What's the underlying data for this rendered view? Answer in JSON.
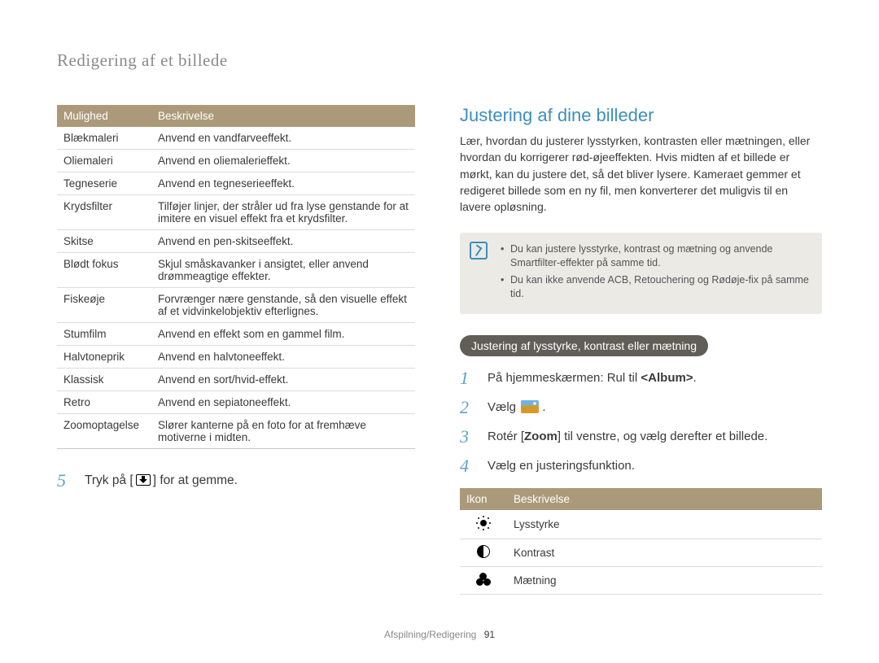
{
  "page_subtitle": "Redigering af et billede",
  "left_table": {
    "headers": [
      "Mulighed",
      "Beskrivelse"
    ],
    "rows": [
      {
        "opt": "Blækmaleri",
        "desc": "Anvend en vandfarveeffekt."
      },
      {
        "opt": "Oliemaleri",
        "desc": "Anvend en oliemalerieffekt."
      },
      {
        "opt": "Tegneserie",
        "desc": "Anvend en tegneserieeffekt."
      },
      {
        "opt": "Krydsfilter",
        "desc": "Tilføjer linjer, der stråler ud fra lyse genstande for at imitere en visuel effekt fra et krydsfilter."
      },
      {
        "opt": "Skitse",
        "desc": "Anvend en pen-skitseeffekt."
      },
      {
        "opt": "Blødt fokus",
        "desc": "Skjul småskavanker i ansigtet, eller anvend drømmeagtige effekter."
      },
      {
        "opt": "Fiskeøje",
        "desc": "Forvrænger nære genstande, så den visuelle effekt af et vidvinkelobjektiv efterlignes."
      },
      {
        "opt": "Stumfilm",
        "desc": "Anvend en effekt som en gammel film."
      },
      {
        "opt": "Halvtoneprik",
        "desc": "Anvend en halvtoneeffekt."
      },
      {
        "opt": "Klassisk",
        "desc": "Anvend en sort/hvid-effekt."
      },
      {
        "opt": "Retro",
        "desc": "Anvend en sepiatoneeffekt."
      },
      {
        "opt": "Zoomoptagelse",
        "desc": "Slører kanterne på en foto for at fremhæve motiverne i midten."
      }
    ]
  },
  "left_step": {
    "num": "5",
    "before": "Tryk på [",
    "after": "] for at gemme."
  },
  "right": {
    "title": "Justering af dine billeder",
    "body": "Lær, hvordan du justerer lysstyrken, kontrasten eller mætningen, eller hvordan du korrigerer rød-øjeeffekten. Hvis midten af et billede er mørkt, kan du justere det, så det bliver lysere. Kameraet gemmer et redigeret billede som en ny fil, men konverterer det muligvis til en lavere opløsning.",
    "notes": [
      "Du kan justere lysstyrke, kontrast og mætning og anvende Smartfilter-effekter på samme tid.",
      "Du kan ikke anvende ACB, Retouchering og Rødøje-fix på samme tid."
    ],
    "subhead": "Justering af lysstyrke, kontrast eller mætning",
    "steps": {
      "s1": {
        "num": "1",
        "before": "På hjemmeskærmen: Rul til ",
        "bold": "<Album>",
        "after": "."
      },
      "s2": {
        "num": "2",
        "text": "Vælg "
      },
      "s3": {
        "num": "3",
        "before": "Rotér [",
        "bold": "Zoom",
        "after": "] til venstre, og vælg derefter et billede."
      },
      "s4": {
        "num": "4",
        "text": "Vælg en justeringsfunktion."
      }
    },
    "icon_table": {
      "headers": [
        "Ikon",
        "Beskrivelse"
      ],
      "rows": [
        {
          "key": "brightness",
          "label": "Lysstyrke"
        },
        {
          "key": "contrast",
          "label": "Kontrast"
        },
        {
          "key": "saturation",
          "label": "Mætning"
        }
      ]
    }
  },
  "footer": {
    "section": "Afspilning/Redigering",
    "page": "91"
  }
}
